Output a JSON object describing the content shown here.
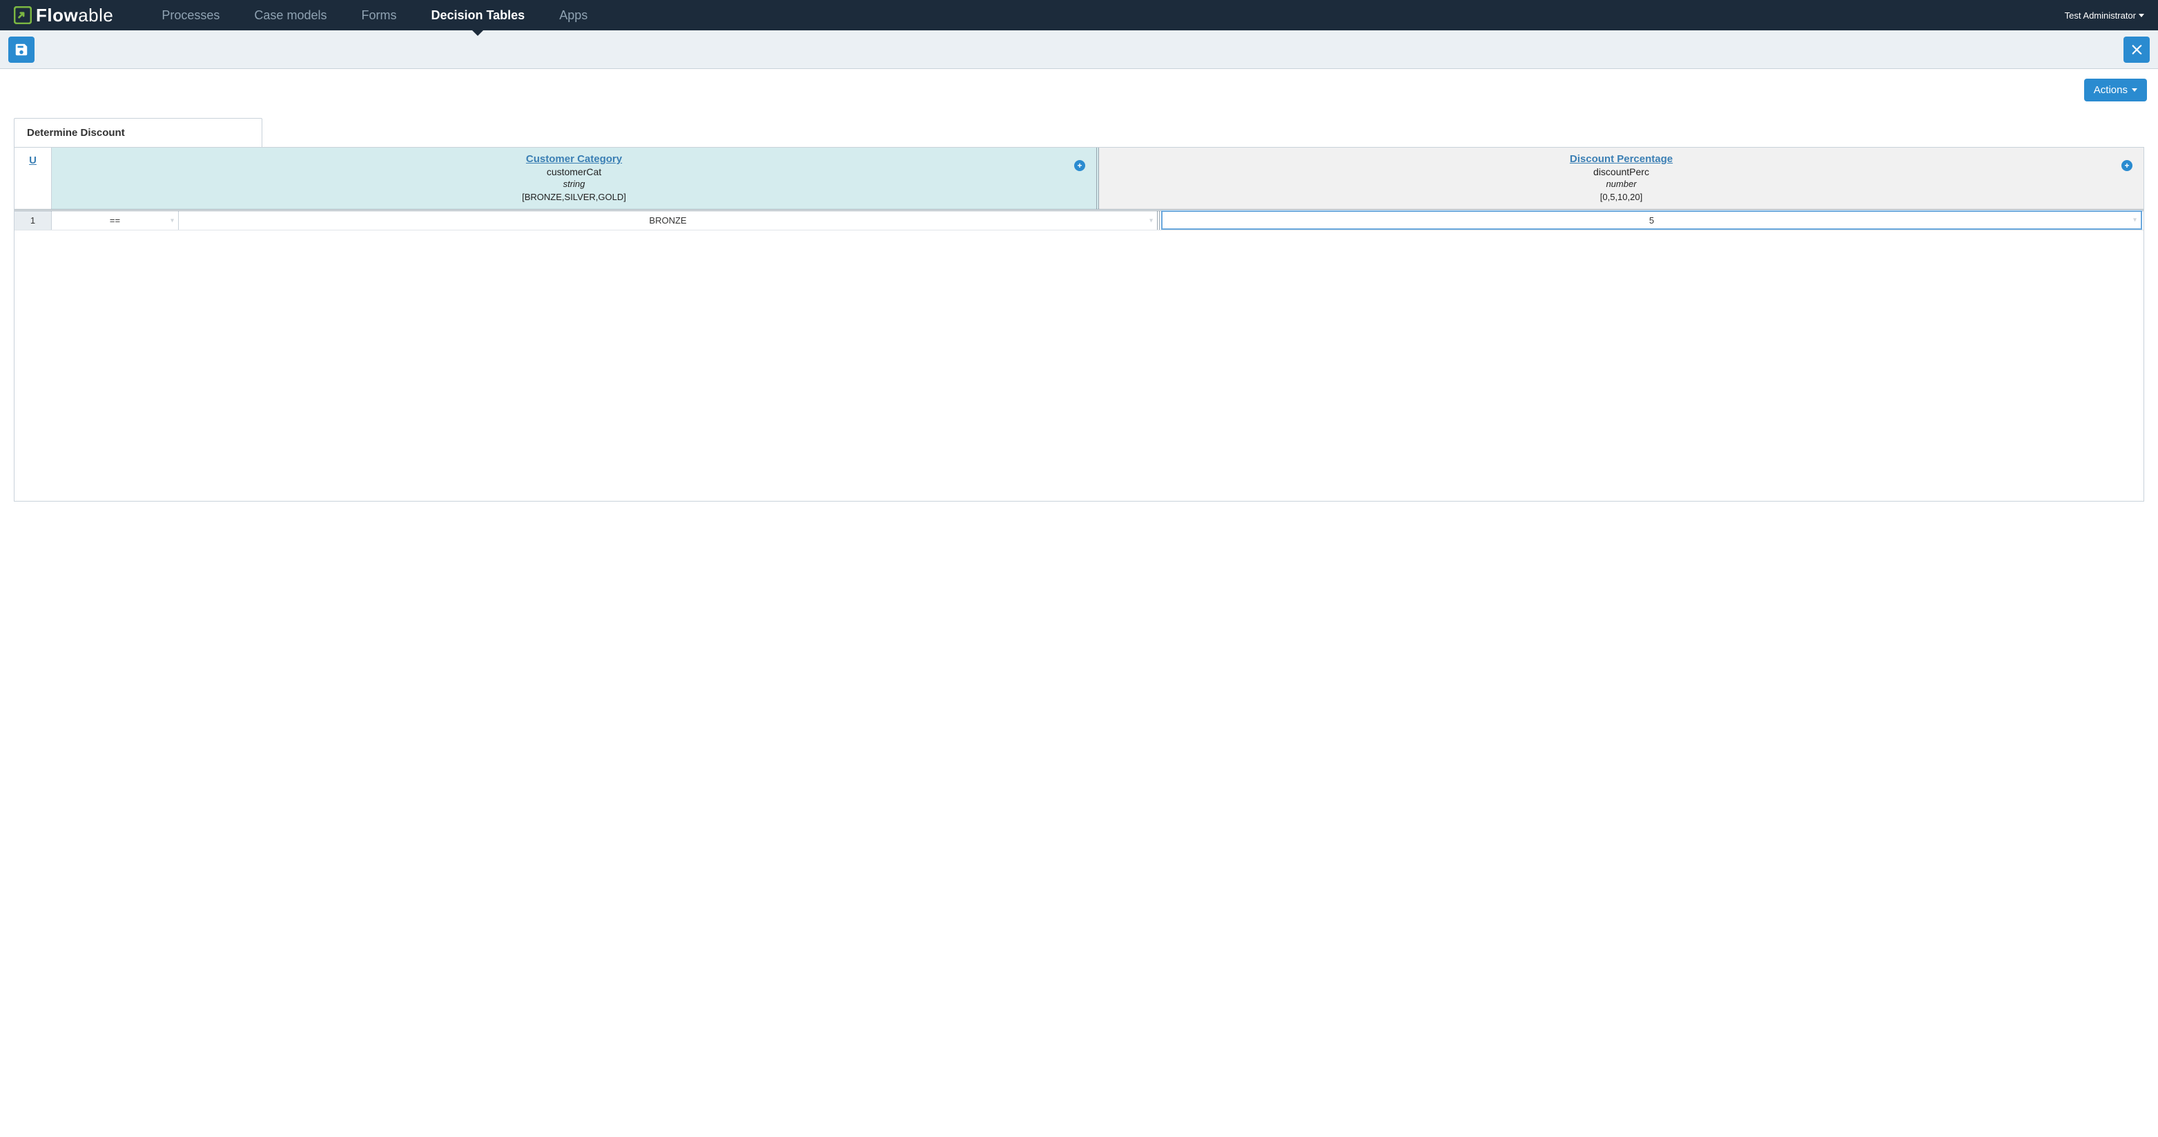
{
  "nav": {
    "items": [
      "Processes",
      "Case models",
      "Forms",
      "Decision Tables",
      "Apps"
    ],
    "activeIndex": 3,
    "user": "Test Administrator"
  },
  "toolbar": {
    "save_title": "Save",
    "close_title": "Close"
  },
  "actions": {
    "label": "Actions"
  },
  "table": {
    "name": "Determine Discount",
    "hitPolicy": "U",
    "inputs": [
      {
        "label": "Customer Category",
        "variable": "customerCat",
        "type": "string",
        "values": "[BRONZE,SILVER,GOLD]"
      }
    ],
    "outputs": [
      {
        "label": "Discount Percentage",
        "variable": "discountPerc",
        "type": "number",
        "values": "[0,5,10,20]"
      }
    ],
    "rows": [
      {
        "num": "1",
        "operator": "==",
        "inputValue": "BRONZE",
        "outputValue": "5"
      }
    ]
  }
}
